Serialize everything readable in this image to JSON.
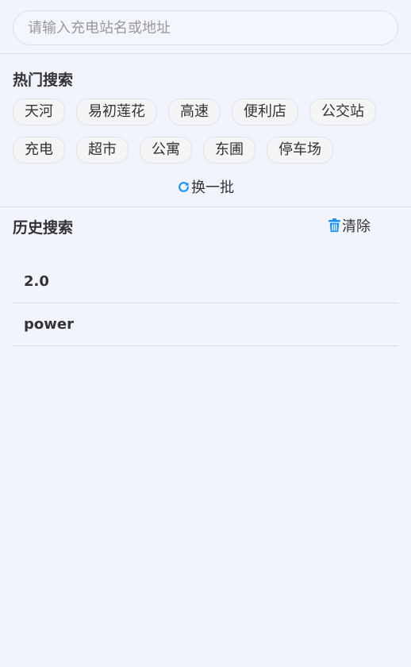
{
  "search": {
    "placeholder": "请输入充电站名或地址",
    "value": ""
  },
  "hot_search": {
    "title": "热门搜索",
    "rows": [
      [
        "天河",
        "易初莲花",
        "高速",
        "便利店",
        "公交站"
      ],
      [
        "充电",
        "超市",
        "公寓",
        "东圃",
        "停车场"
      ]
    ],
    "refresh_label": "换一批",
    "refresh_icon": "refresh-icon"
  },
  "history": {
    "title": "历史搜索",
    "clear_label": "清除",
    "clear_icon": "trash-icon",
    "items": [
      "2.0",
      "power"
    ]
  },
  "colors": {
    "background": "#f1f4fd",
    "accent": "#1890ff",
    "tag_background": "#f3f5f6",
    "text": "#333333"
  }
}
